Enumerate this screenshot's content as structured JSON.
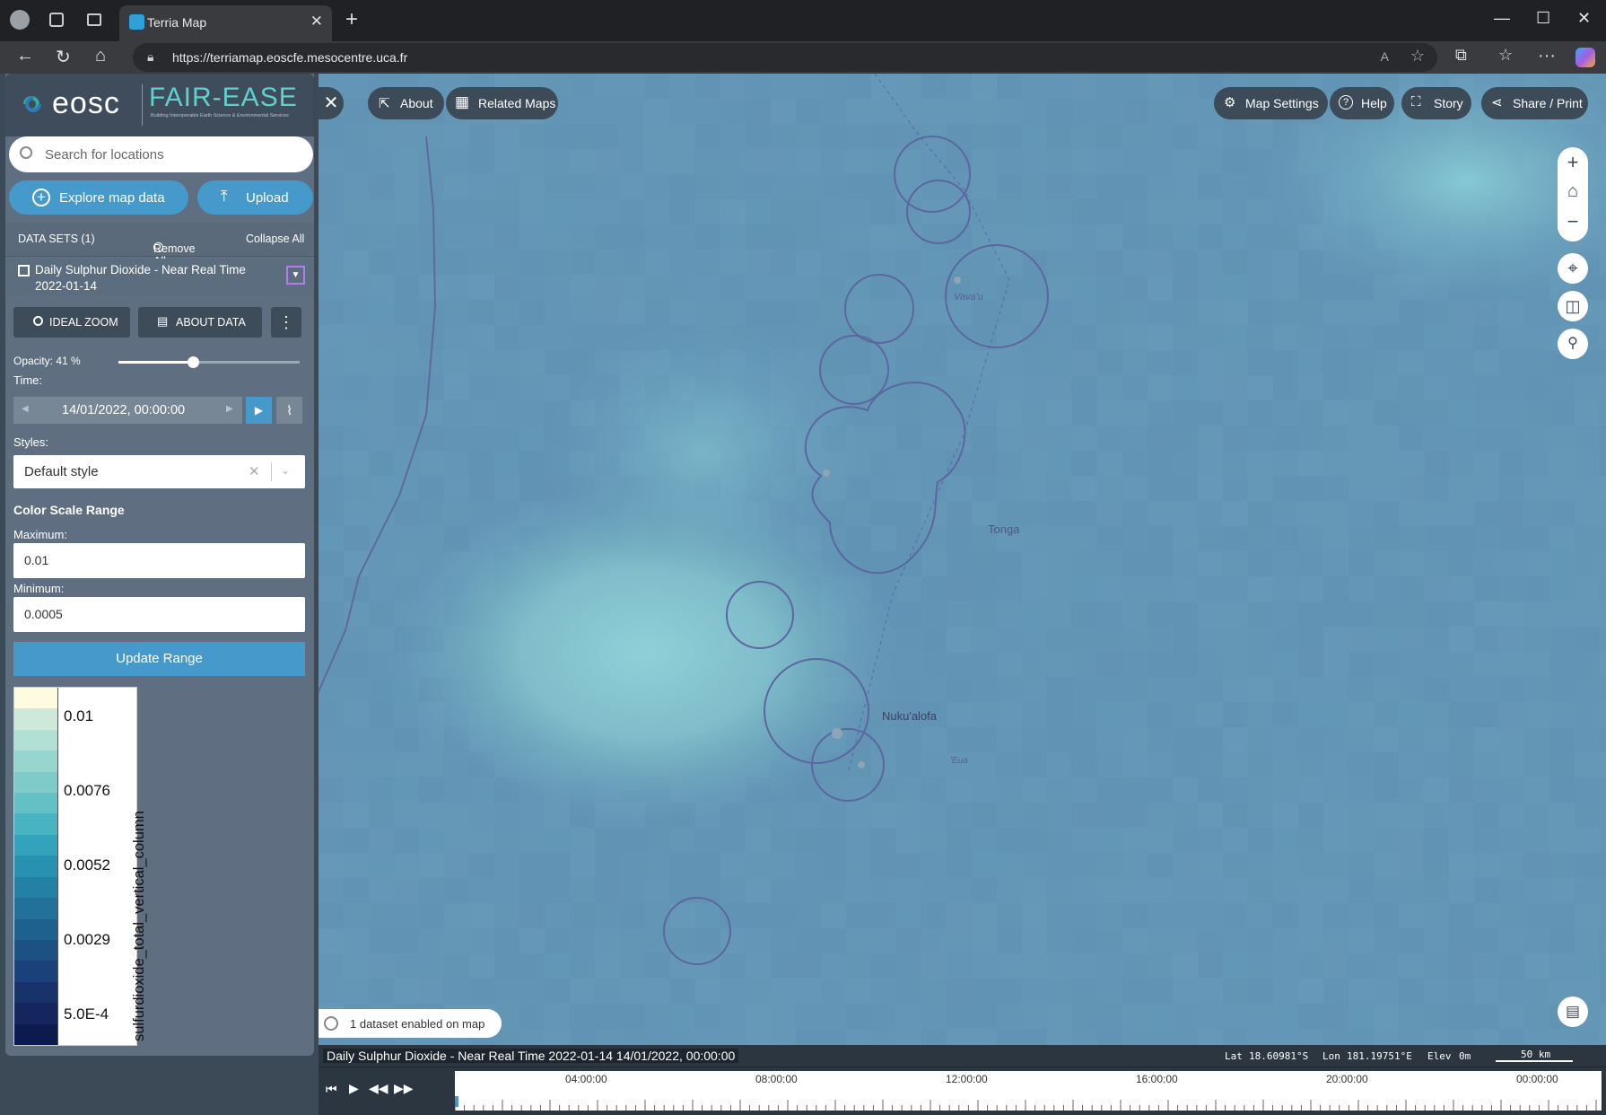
{
  "browser": {
    "tab_title": "Terria Map",
    "url": "https://terriamap.eoscfe.mesocentre.uca.fr"
  },
  "logo": {
    "eosc": "eosc",
    "fairease": "FAIR-EASE",
    "tagline": "Building Interoperable Earth Science & Environmental Services"
  },
  "search": {
    "placeholder": "Search for locations"
  },
  "buttons": {
    "explore": "Explore map data",
    "upload": "Upload"
  },
  "datasets": {
    "header": "DATA SETS (1)",
    "remove_all": "Remove All",
    "collapse_all": "Collapse All"
  },
  "layer": {
    "title": "Daily Sulphur Dioxide - Near Real Time 2022-01-14",
    "ideal_zoom": "IDEAL ZOOM",
    "about_data": "ABOUT DATA",
    "opacity_label": "Opacity: 41 %",
    "opacity_value": 0.41,
    "time_label": "Time:",
    "time_value": "14/01/2022, 00:00:00",
    "styles_label": "Styles:",
    "style_value": "Default style",
    "color_scale_title": "Color Scale Range",
    "maximum_label": "Maximum:",
    "maximum_value": "0.01",
    "minimum_label": "Minimum:",
    "minimum_value": "0.0005",
    "update_range": "Update Range"
  },
  "legend": {
    "values": [
      "0.01",
      "0.0076",
      "0.0052",
      "0.0029",
      "5.0E-4"
    ],
    "title": "sulfurdioxide_total_vertical_column",
    "colors": [
      "#fefce0",
      "#cde9d9",
      "#b2e0d5",
      "#97d5cf",
      "#7ecbc9",
      "#63c0c5",
      "#48b3c1",
      "#33a2bb",
      "#2891b1",
      "#2481a6",
      "#21719a",
      "#1e618f",
      "#1c5184",
      "#1a4179",
      "#18336b",
      "#15265e",
      "#0c1b4f"
    ]
  },
  "map": {
    "about": "About",
    "related_maps": "Related Maps",
    "map_settings": "Map Settings",
    "help": "Help",
    "story": "Story",
    "share_print": "Share / Print",
    "places": {
      "vavau": "Vava'u",
      "tonga": "Tonga",
      "nukualofa": "Nuku'alofa",
      "eua": "'Eua"
    },
    "datasets_enabled": "1 dataset enabled on map"
  },
  "status": {
    "layer_time": "Daily Sulphur Dioxide - Near Real Time 2022-01-14 14/01/2022, 00:00:00",
    "lat_label": "Lat",
    "lat": "18.60981°S",
    "lon_label": "Lon",
    "lon": "181.19751°E",
    "elev_label": "Elev",
    "elev": "0m",
    "scale": "50 km"
  },
  "timeline": {
    "ticks": [
      "04:00:00",
      "08:00:00",
      "12:00:00",
      "16:00:00",
      "20:00:00",
      "00:00:00"
    ]
  }
}
